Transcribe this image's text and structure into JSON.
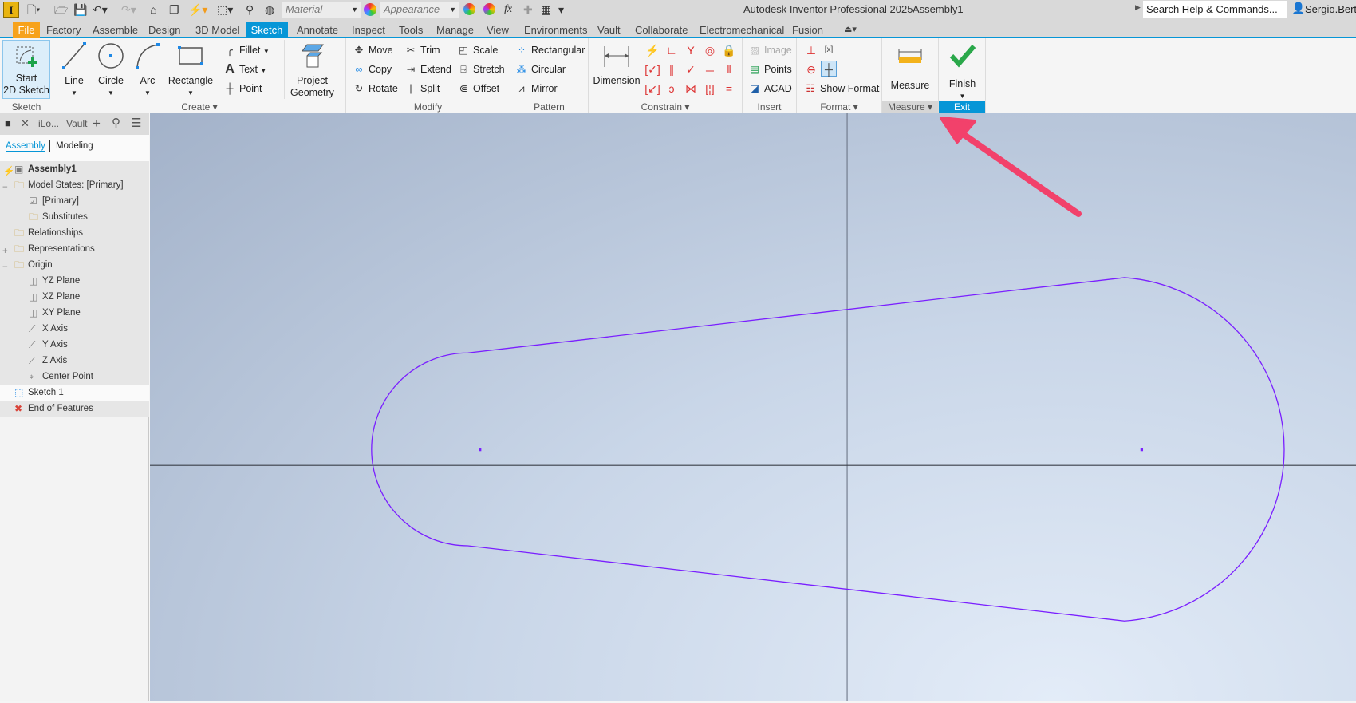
{
  "titlebar": {
    "app_title": "Autodesk Inventor Professional 2025",
    "doc_title": "Assembly1",
    "material": "Material",
    "appearance": "Appearance",
    "search": "Search Help & Commands...",
    "user": "Sergio.Berti",
    "logo": "I"
  },
  "tabs": [
    "File",
    "Factory",
    "Assemble",
    "Design",
    "3D Model",
    "Sketch",
    "Annotate",
    "Inspect",
    "Tools",
    "Manage",
    "View",
    "Environments",
    "Vault",
    "Collaborate",
    "Electromechanical",
    "Fusion"
  ],
  "active_tab": "Sketch",
  "ribbon": {
    "sketch": {
      "label": "Sketch",
      "start1": "Start",
      "start2": "2D Sketch"
    },
    "create": {
      "label": "Create ▾",
      "line": "Line",
      "circle": "Circle",
      "arc": "Arc",
      "rectangle": "Rectangle",
      "fillet": "Fillet",
      "text": "Text",
      "point": "Point",
      "project1": "Project",
      "project2": "Geometry"
    },
    "modify": {
      "label": "Modify",
      "move": "Move",
      "copy": "Copy",
      "rotate": "Rotate",
      "trim": "Trim",
      "extend": "Extend",
      "split": "Split",
      "scale": "Scale",
      "stretch": "Stretch",
      "offset": "Offset"
    },
    "pattern": {
      "label": "Pattern",
      "rectangular": "Rectangular",
      "circular": "Circular",
      "mirror": "Mirror"
    },
    "constrain": {
      "label": "Constrain ▾",
      "dimension": "Dimension"
    },
    "insert": {
      "label": "Insert",
      "image": "Image",
      "points": "Points",
      "acad": "ACAD"
    },
    "format": {
      "label": "Format ▾",
      "show_format": "Show Format"
    },
    "measure": {
      "label": "Measure ▾",
      "measure": "Measure"
    },
    "exit": {
      "label": "Exit",
      "finish": "Finish"
    }
  },
  "browser": {
    "tabs": [
      "iLo...",
      "Vault"
    ],
    "views": [
      "Assembly",
      "Modeling"
    ],
    "tree": [
      {
        "label": "Assembly1",
        "level": 0
      },
      {
        "label": "Model States: [Primary]",
        "level": 0
      },
      {
        "label": "[Primary]",
        "level": 1
      },
      {
        "label": "Substitutes",
        "level": 1
      },
      {
        "label": "Relationships",
        "level": 0
      },
      {
        "label": "Representations",
        "level": 0
      },
      {
        "label": "Origin",
        "level": 0
      },
      {
        "label": "YZ Plane",
        "level": 1
      },
      {
        "label": "XZ Plane",
        "level": 1
      },
      {
        "label": "XY Plane",
        "level": 1
      },
      {
        "label": "X Axis",
        "level": 1
      },
      {
        "label": "Y Axis",
        "level": 1
      },
      {
        "label": "Z Axis",
        "level": 1
      },
      {
        "label": "Center Point",
        "level": 1
      },
      {
        "label": "Sketch 1",
        "level": 0
      },
      {
        "label": "End of Features",
        "level": 0
      }
    ]
  },
  "colors": {
    "accent": "#0696d7",
    "file_tab": "#f7a21b",
    "sketch_curve": "#7a1fff",
    "annotation_arrow": "#f2416b"
  }
}
